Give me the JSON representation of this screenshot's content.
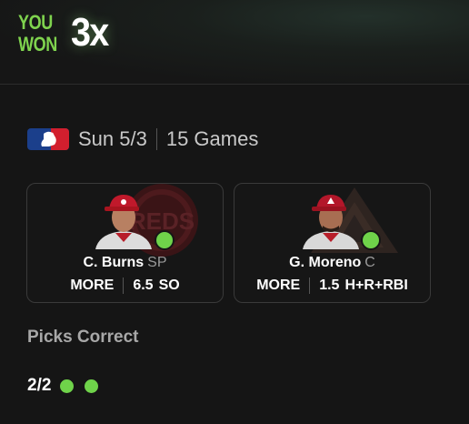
{
  "header": {
    "you": "YOU",
    "won": "WON",
    "multiplier": "3x"
  },
  "game": {
    "league_icon": "mlb-logo-icon",
    "date": "Sun 5/3",
    "games": "15 Games"
  },
  "picks": [
    {
      "player": "C. Burns",
      "position": "SP",
      "direction": "MORE",
      "line": "6.5",
      "stat": "SO",
      "team_icon": "reds-logo-icon",
      "result": "correct"
    },
    {
      "player": "G. Moreno",
      "position": "C",
      "direction": "MORE",
      "line": "1.5",
      "stat": "H+R+RBI",
      "team_icon": "diamondbacks-logo-icon",
      "result": "correct"
    }
  ],
  "summary": {
    "label": "Picks Correct",
    "count": "2/2"
  },
  "colors": {
    "accent_green": "#6fd34a",
    "background": "#151515"
  }
}
